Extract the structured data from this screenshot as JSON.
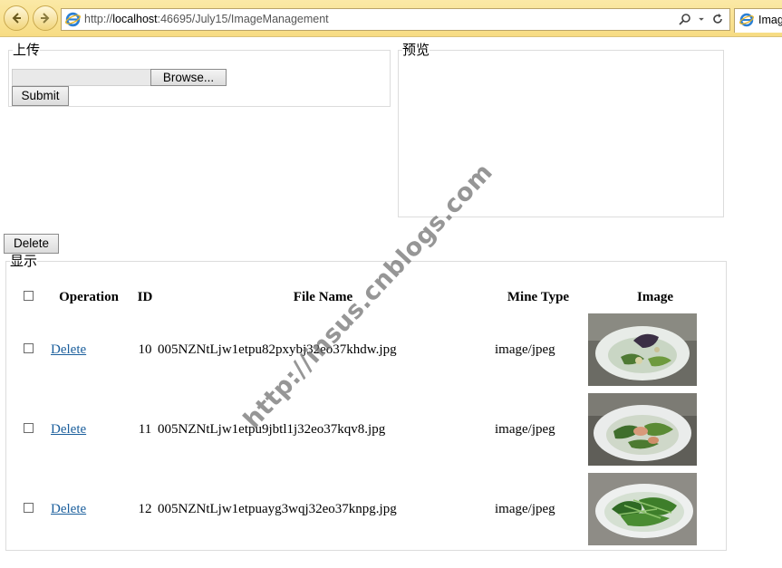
{
  "browser": {
    "url_prefix": "http://",
    "url_host": "localhost",
    "url_rest": ":46695/July15/ImageManagement",
    "tab_title": "Imag"
  },
  "upload": {
    "legend": "上传",
    "browse_label": "Browse...",
    "submit_label": "Submit"
  },
  "preview": {
    "legend": "预览"
  },
  "delete_button_label": "Delete",
  "display": {
    "legend": "显示",
    "columns": [
      "Operation",
      "ID",
      "File Name",
      "Mine Type",
      "Image"
    ],
    "rows": [
      {
        "action": "Delete",
        "id": "10",
        "file_name": "005NZNtLjw1etpu82pxybj32eo37khdw.jpg",
        "mime": "image/jpeg",
        "thumb": "plate-eggplant-vegetables"
      },
      {
        "action": "Delete",
        "id": "11",
        "file_name": "005NZNtLjw1etpu9jbtl1j32eo37kqv8.jpg",
        "mime": "image/jpeg",
        "thumb": "plate-shrimp-vegetables"
      },
      {
        "action": "Delete",
        "id": "12",
        "file_name": "005NZNtLjw1etpuayg3wqj32eo37knpg.jpg",
        "mime": "image/jpeg",
        "thumb": "plate-greens"
      }
    ]
  },
  "watermark": "http://insus.cnblogs.com"
}
